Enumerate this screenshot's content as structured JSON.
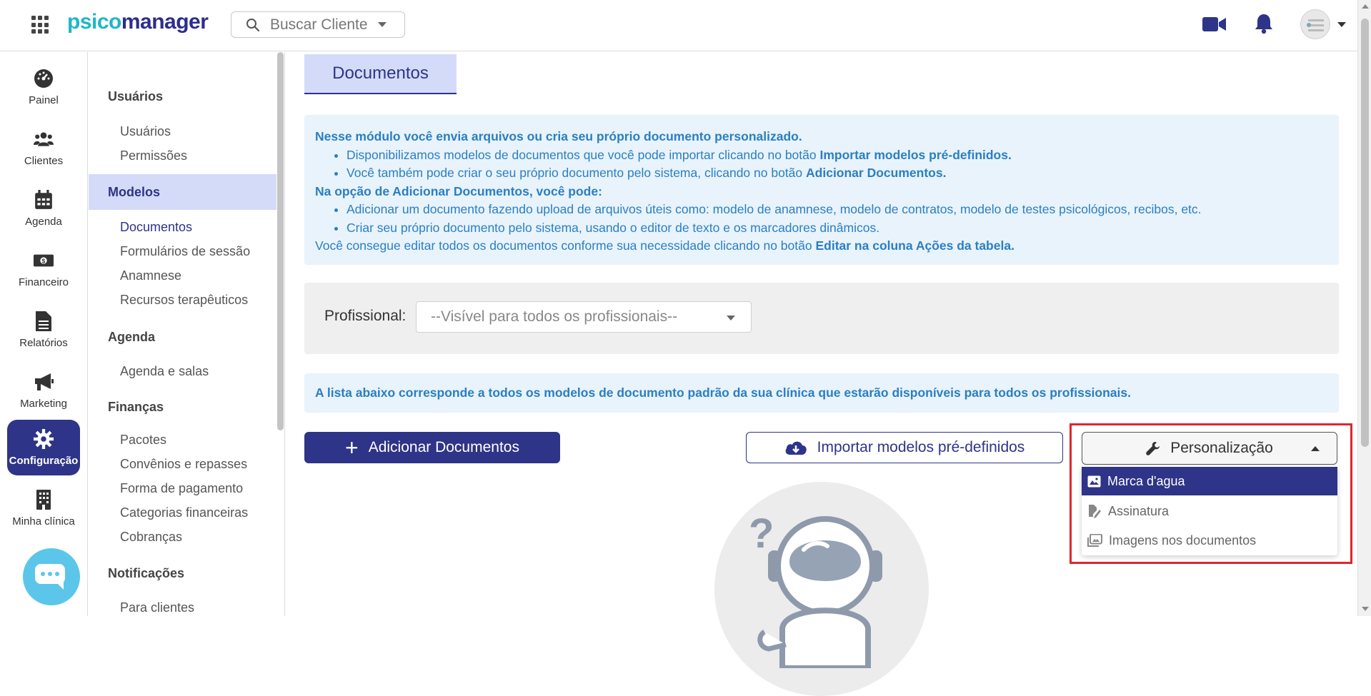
{
  "brand": {
    "part1": "psico",
    "part2": "manager",
    "accent": "#1fb6c9",
    "primary": "#2e3487"
  },
  "topbar": {
    "search_label": "Buscar Cliente",
    "icons": [
      "apps-grid-icon",
      "search-icon",
      "video-camera-icon",
      "bell-icon",
      "avatar"
    ]
  },
  "leftnav": {
    "items": [
      {
        "label": "Painel",
        "icon": "dashboard-gauge-icon"
      },
      {
        "label": "Clientes",
        "icon": "users-icon"
      },
      {
        "label": "Agenda",
        "icon": "calendar-icon"
      },
      {
        "label": "Financeiro",
        "icon": "money-icon"
      },
      {
        "label": "Relatórios",
        "icon": "report-file-icon"
      },
      {
        "label": "Marketing",
        "icon": "megaphone-icon"
      },
      {
        "label": "Configuração",
        "icon": "gear-icon",
        "active": true
      },
      {
        "label": "Minha clínica",
        "icon": "building-icon"
      }
    ]
  },
  "subnav": {
    "sections": [
      {
        "title": "Usuários",
        "items": [
          "Usuários",
          "Permissões"
        ]
      },
      {
        "title": "Modelos",
        "active": true,
        "items": [
          "Documentos",
          "Formulários de sessão",
          "Anamnese",
          "Recursos terapêuticos"
        ],
        "active_item": "Documentos"
      },
      {
        "title": "Agenda",
        "items": [
          "Agenda e salas"
        ]
      },
      {
        "title": "Finanças",
        "items": [
          "Pacotes",
          "Convênios e repasses",
          "Forma de pagamento",
          "Categorias financeiras",
          "Cobranças"
        ]
      },
      {
        "title": "Notificações",
        "items": [
          "Para clientes"
        ]
      }
    ]
  },
  "main": {
    "title": "Documentos",
    "info": {
      "intro": "Nesse módulo você envia arquivos ou cria seu próprio documento personalizado.",
      "b1_text": "Disponibilizamos modelos de documentos que você pode importar clicando no botão ",
      "b1_bold": "Importar modelos pré-definidos.",
      "b2_text": "Você também pode criar o seu próprio documento pelo sistema, clicando no botão ",
      "b2_bold": "Adicionar Documentos.",
      "heading2": "Na opção de Adicionar Documentos, você pode:",
      "b3": "Adicionar um documento fazendo upload de arquivos úteis como: modelo de anamnese, modelo de contratos, modelo de testes psicológicos, recibos, etc.",
      "b4": "Criar seu próprio documento pelo sistema, usando o editor de texto e os marcadores dinâmicos.",
      "footer_text": "Você consegue editar todos os documentos conforme sua necessidade clicando no botão ",
      "footer_bold": "Editar na coluna Ações da tabela."
    },
    "filter": {
      "label": "Profissional:",
      "selected": "--Visível para todos os profissionais--"
    },
    "note": "A lista abaixo corresponde a todos os modelos de documento padrão da sua clínica que estarão disponíveis para todos os profissionais.",
    "buttons": {
      "add": "Adicionar Documentos",
      "import": "Importar modelos pré-definidos",
      "personalize": "Personalização"
    },
    "dropdown": [
      {
        "label": "Marca d'agua",
        "icon": "image-icon",
        "active": true
      },
      {
        "label": "Assinatura",
        "icon": "signature-icon"
      },
      {
        "label": "Imagens nos documentos",
        "icon": "images-icon"
      }
    ],
    "empty_state": {
      "icon": "astronaut-question-illustration"
    }
  }
}
